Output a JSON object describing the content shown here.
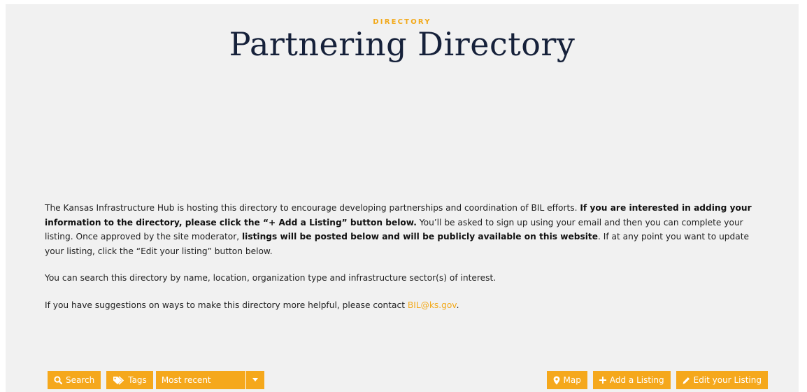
{
  "header": {
    "eyebrow": "DIRECTORY",
    "title": "Partnering Directory"
  },
  "intro": {
    "p1_a": "The Kansas Infrastructure Hub is hosting this directory to encourage developing partnerships and coordination of BIL efforts. ",
    "p1_b": "If you are interested in adding your information to the directory, please click the “+ Add a Listing” button below.",
    "p1_c": " You’ll be asked to sign up using your email and then you can complete your listing. Once approved by the site moderator, ",
    "p1_d": "listings will be posted below and will be publicly available on this website",
    "p1_e": ". If at any point you want to update your listing, click the “Edit your listing” button below.",
    "p2": "You can search this directory by name, location, organization type and infrastructure sector(s) of interest.",
    "p3_a": "If you have suggestions on ways to make this directory more helpful, please contact ",
    "p3_link": "BIL@ks.gov",
    "p3_b": "."
  },
  "toolbar": {
    "search_label": "Search",
    "tags_label": "Tags",
    "sort_selected": "Most recent",
    "map_label": "Map",
    "add_label": "Add a Listing",
    "edit_label": "Edit your Listing"
  },
  "icons": {
    "search": "search-icon",
    "tags": "tags-icon",
    "caret": "caret-down-icon",
    "map": "map-marker-icon",
    "add": "plus-icon",
    "edit": "pencil-icon"
  },
  "colors": {
    "accent": "#f5a81c",
    "title": "#16213a",
    "panel": "#f1f1f1",
    "link": "#f2a91a"
  }
}
